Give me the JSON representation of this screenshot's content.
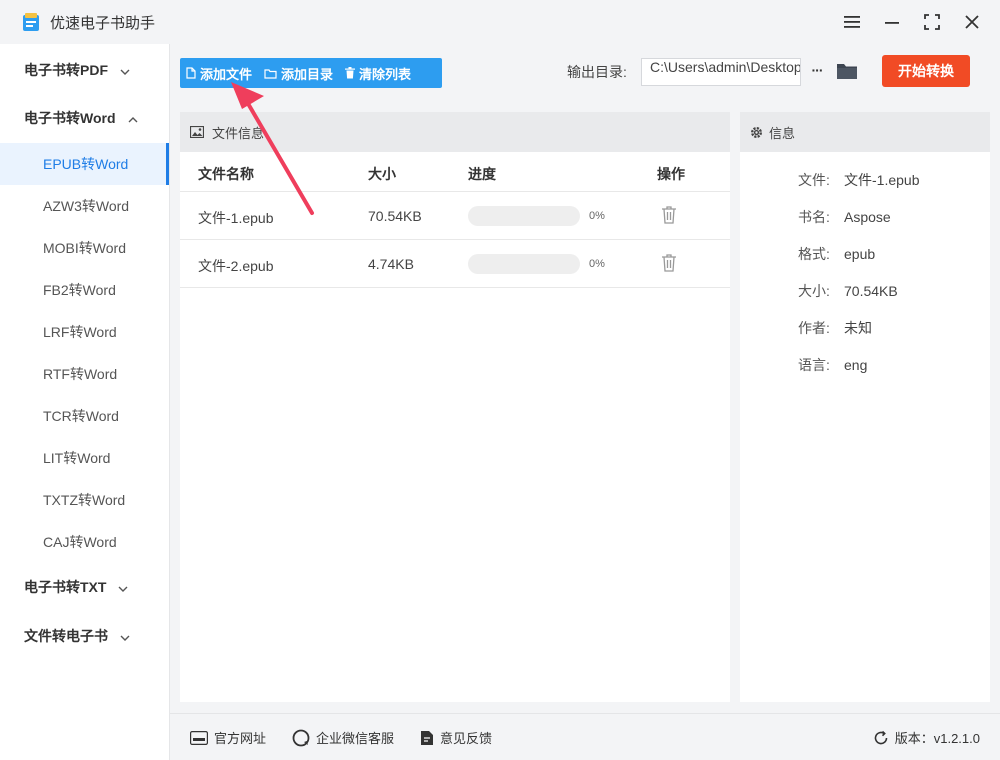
{
  "app": {
    "title": "优速电子书助手"
  },
  "sidebar": {
    "groups": [
      {
        "label": "电子书转PDF",
        "expanded": false
      },
      {
        "label": "电子书转Word",
        "expanded": true
      },
      {
        "label": "电子书转TXT",
        "expanded": false
      },
      {
        "label": "文件转电子书",
        "expanded": false
      }
    ],
    "word_items": [
      {
        "label": "EPUB转Word",
        "active": true
      },
      {
        "label": "AZW3转Word"
      },
      {
        "label": "MOBI转Word"
      },
      {
        "label": "FB2转Word"
      },
      {
        "label": "LRF转Word"
      },
      {
        "label": "RTF转Word"
      },
      {
        "label": "TCR转Word"
      },
      {
        "label": "LIT转Word"
      },
      {
        "label": "TXTZ转Word"
      },
      {
        "label": "CAJ转Word"
      }
    ]
  },
  "toolbar": {
    "add_file": "添加文件",
    "add_dir": "添加目录",
    "clear_list": "清除列表",
    "output_label": "输出目录:",
    "output_path": "C:\\Users\\admin\\Desktop",
    "more": "···",
    "start": "开始转换"
  },
  "file_panel": {
    "title": "文件信息",
    "columns": [
      "文件名称",
      "大小",
      "进度",
      "操作"
    ],
    "rows": [
      {
        "name": "文件-1.epub",
        "size": "70.54KB",
        "progress": 0,
        "progress_text": "0%"
      },
      {
        "name": "文件-2.epub",
        "size": "4.74KB",
        "progress": 0,
        "progress_text": "0%"
      }
    ]
  },
  "info_panel": {
    "title": "信息",
    "fields": [
      {
        "label": "文件:",
        "value": "文件-1.epub"
      },
      {
        "label": "书名:",
        "value": "Aspose"
      },
      {
        "label": "格式:",
        "value": "epub"
      },
      {
        "label": "大小:",
        "value": "70.54KB"
      },
      {
        "label": "作者:",
        "value": "未知"
      },
      {
        "label": "语言:",
        "value": "eng"
      }
    ]
  },
  "footer": {
    "website": "官方网址",
    "wechat": "企业微信客服",
    "feedback": "意见反馈",
    "version": "版本：v1.2.1.0"
  },
  "colors": {
    "accent": "#1f7de6",
    "toolbar_blue": "#2d9df0",
    "start_red": "#f14b25",
    "annotation_arrow": "#ef3e5c"
  },
  "icons": {
    "logo": "book-logo-icon",
    "menu": "hamburger-icon",
    "minimize": "minimize-icon",
    "maximize": "maximize-icon",
    "close": "close-icon",
    "folder": "folder-icon",
    "delete": "trash-icon",
    "image": "image-icon",
    "gear": "gear-icon",
    "refresh": "refresh-icon"
  }
}
